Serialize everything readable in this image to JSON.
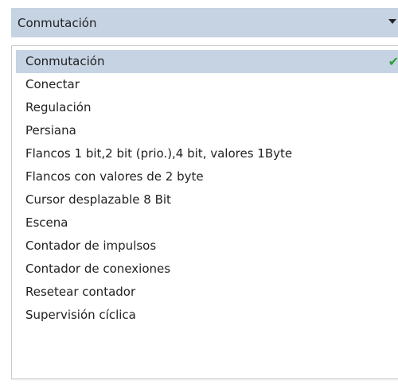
{
  "combo": {
    "selected_value": "Conmutación",
    "arrow_icon": "triangle-down-icon"
  },
  "dropdown": {
    "items": [
      {
        "label": "Conmutación",
        "selected": true
      },
      {
        "label": "Conectar",
        "selected": false
      },
      {
        "label": "Regulación",
        "selected": false
      },
      {
        "label": "Persiana",
        "selected": false
      },
      {
        "label": "Flancos 1 bit,2 bit (prio.),4 bit, valores 1Byte",
        "selected": false
      },
      {
        "label": "Flancos con valores de 2 byte",
        "selected": false
      },
      {
        "label": "Cursor desplazable 8 Bit",
        "selected": false
      },
      {
        "label": "Escena",
        "selected": false
      },
      {
        "label": "Contador de impulsos",
        "selected": false
      },
      {
        "label": "Contador de conexiones",
        "selected": false
      },
      {
        "label": "Resetear contador",
        "selected": false
      },
      {
        "label": "Supervisión cíclica",
        "selected": false
      }
    ],
    "check_icon": "checkmark-icon",
    "check_glyph": "✔"
  },
  "colors": {
    "selection_background": "#c5d3e3",
    "check_color": "#2e9e3a",
    "text": "#222222"
  }
}
